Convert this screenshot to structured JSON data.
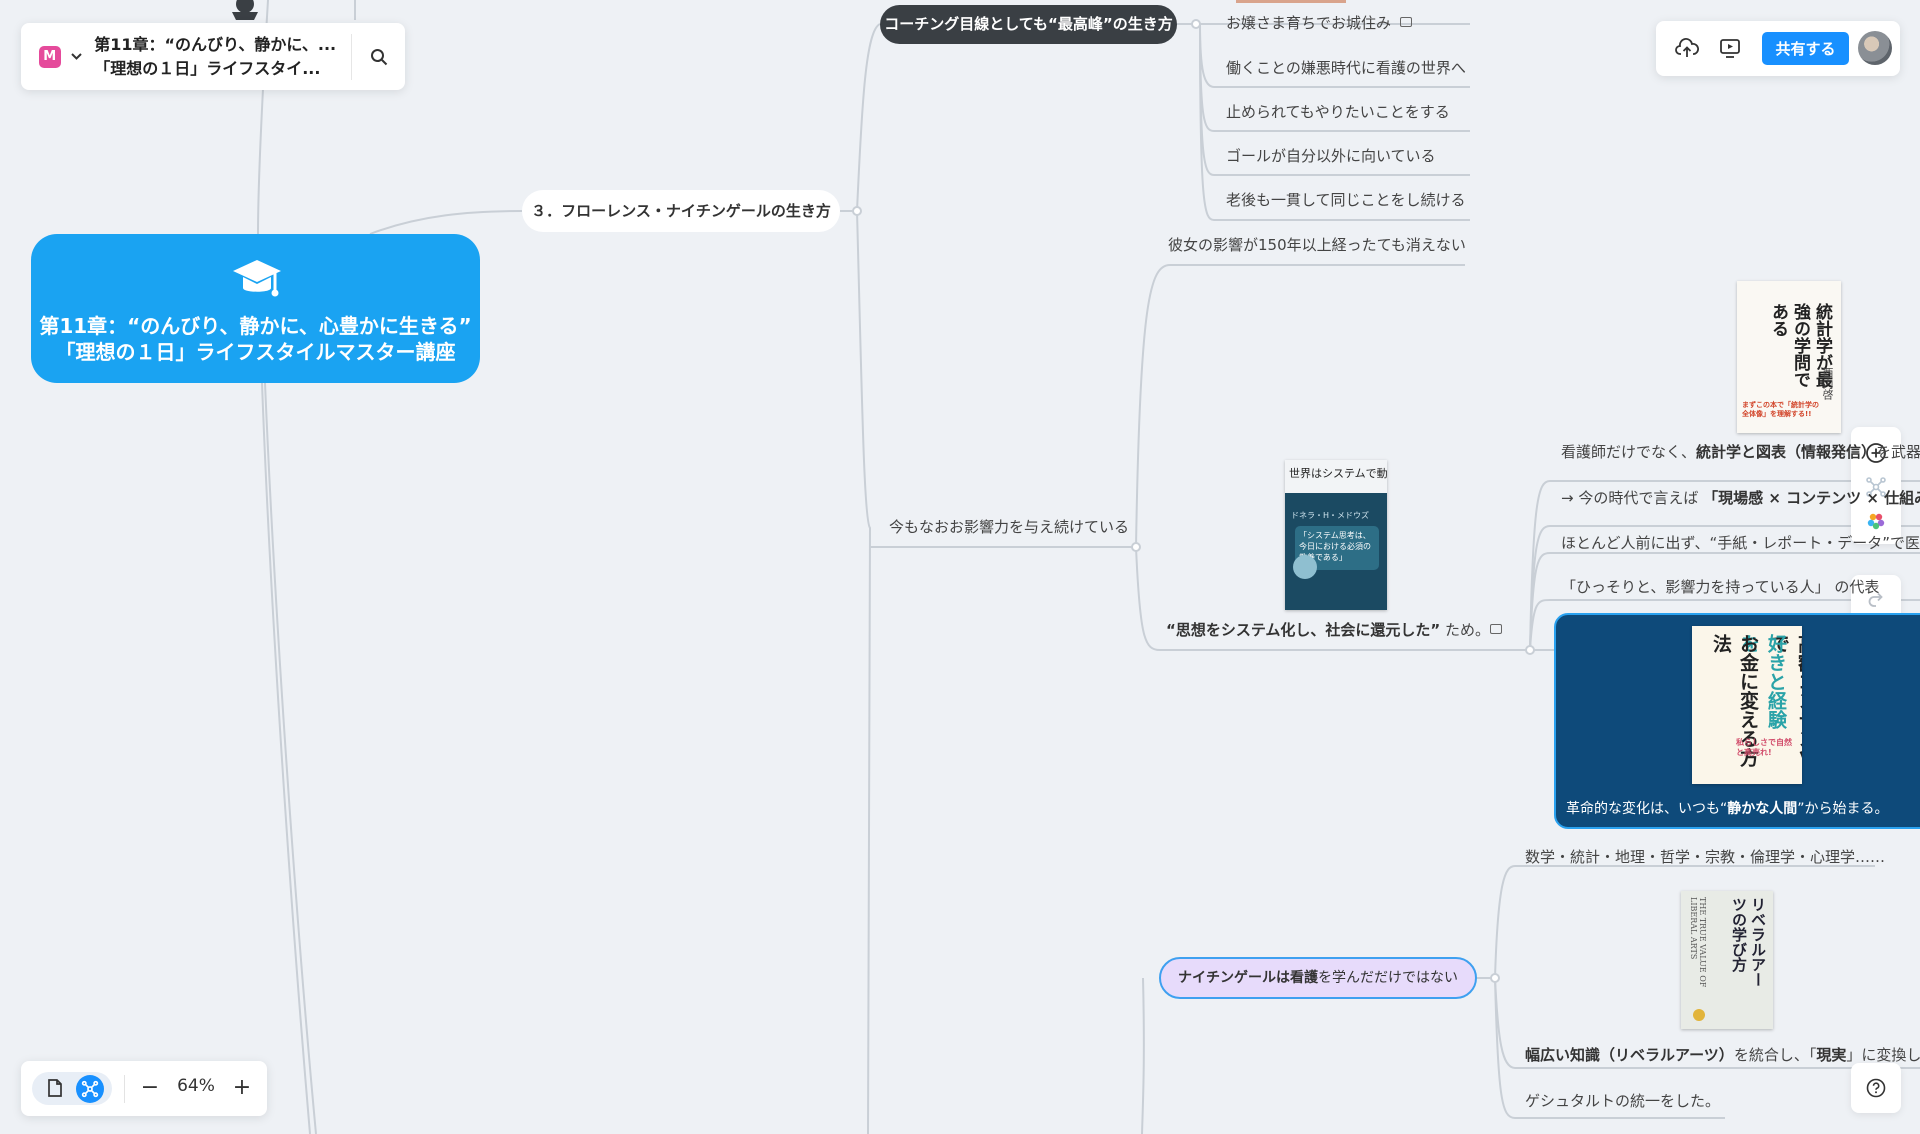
{
  "header": {
    "logo_letter": "M",
    "title_line1": "第11章：“のんびり、静かに、...",
    "title_line2": "「理想の１日」ライフスタイ..."
  },
  "toolbar_right": {
    "share_label": "共有する"
  },
  "toolbar_bottom": {
    "zoom_level": "64%",
    "zoom_out": "−",
    "zoom_in": "+"
  },
  "mindmap": {
    "root": {
      "line1": "第11章：“のんびり、静かに、心豊かに生きる”",
      "line2": "「理想の１日」ライフスタイルマスター講座"
    },
    "branch3": {
      "label": "３．フローレンス・ナイチンゲールの生き方"
    },
    "coaching": {
      "label": "コーチング目線としても“最高峰”の生き方",
      "children": [
        "お嬢さま育ちでお城住み",
        "働くことの嫌悪時代に看護の世界へ",
        "止められてもやりたいことをする",
        "ゴールが自分以外に向いている",
        "老後も一貫して同じことをし続ける"
      ]
    },
    "influence": {
      "label": "今もなおお影響力を与え続けている",
      "child1": "彼女の影響が150年以上経ったても消えない",
      "system_bold": "“思想をシステム化し、社会に還元した”",
      "system_rest": " ため。",
      "sub": [
        {
          "pre": "看護師だけでなく、",
          "bold": "統計学と図表（情報発信）",
          "post": "を武器にした"
        },
        {
          "pre": "→ 今の時代で言えば ",
          "bold": "「現場感 × コンテンツ × 仕組み化」",
          "post": ""
        },
        {
          "pre": "ほとんど人前に出ず、“手紙・レポート・データ”で医療を変えた",
          "bold": "",
          "post": ""
        },
        {
          "pre": "「ひっそりと、影響力を持っている人」 の代表",
          "bold": "",
          "post": ""
        }
      ],
      "revolution_pre": "革命的な変化は、いつも“",
      "revolution_bold": "静かな人間",
      "revolution_post": "”から始まる。"
    },
    "nightingale": {
      "label_bold": "ナイチンゲールは看護",
      "label_rest": "を学んだだけではない",
      "subjects": "数学・統計・地理・哲学・宗教・倫理学・心理学……",
      "liberal_pre": "幅広い知識（リベラルアーツ）",
      "liberal_mid": "を統合し、「",
      "liberal_bold": "現実",
      "liberal_post": "」に変換した",
      "gestalt": "ゲシュタルトの統一をした。"
    }
  },
  "books": {
    "stat": {
      "title": "統計学が最強の学問である",
      "author": "西内啓",
      "sub": "まずこの本で「統計学の全体像」を理解する!!"
    },
    "system": {
      "title": "世界はシステムで動く",
      "author": "ドネラ・H・メドウズ",
      "sub": "「システム思考は、今日における必須の教養である」"
    },
    "kin": {
      "title": "高額コンテンツで",
      "title2": "好きと経験を",
      "title3": "お金に変える方法",
      "tag": "私らしさで自然と高売れ!"
    },
    "liberal": {
      "title": "リベラルアーツの学び方",
      "en": "THE TRUE VALUE OF LIBERAL ARTS"
    }
  },
  "colors": {
    "root": "#1aa3f2",
    "accent": "#1890ff",
    "dark_pill": "#3a3f44",
    "dark_card": "#0e4a7a",
    "purple_pill": "#e7dbfb"
  }
}
